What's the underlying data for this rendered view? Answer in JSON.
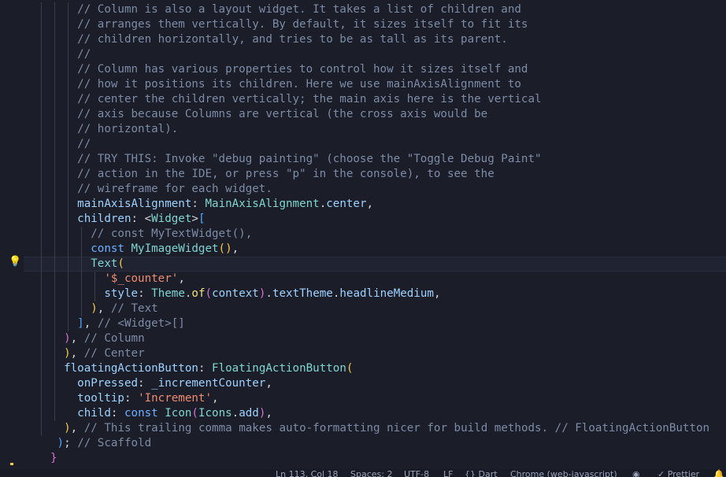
{
  "editor": {
    "lines": [
      [
        [
          "c",
          "    // Column is also a layout widget. It takes a list of children and"
        ]
      ],
      [
        [
          "c",
          "    // arranges them vertically. By default, it sizes itself to fit its"
        ]
      ],
      [
        [
          "c",
          "    // children horizontally, and tries to be as tall as its parent."
        ]
      ],
      [
        [
          "c",
          "    //"
        ]
      ],
      [
        [
          "c",
          "    // Column has various properties to control how it sizes itself and"
        ]
      ],
      [
        [
          "c",
          "    // how it positions its children. Here we use mainAxisAlignment to"
        ]
      ],
      [
        [
          "c",
          "    // center the children vertically; the main axis here is the vertical"
        ]
      ],
      [
        [
          "c",
          "    // axis because Columns are vertical (the cross axis would be"
        ]
      ],
      [
        [
          "c",
          "    // horizontal)."
        ]
      ],
      [
        [
          "c",
          "    //"
        ]
      ],
      [
        [
          "c",
          "    // TRY THIS: Invoke \"debug painting\" (choose the \"Toggle Debug Paint\""
        ]
      ],
      [
        [
          "c",
          "    // action in the IDE, or press \"p\" in the console), to see the"
        ]
      ],
      [
        [
          "c",
          "    // wireframe for each widget."
        ]
      ],
      [
        [
          "pu",
          "    "
        ],
        [
          "p",
          "mainAxisAlignment"
        ],
        [
          "pu",
          ": "
        ],
        [
          "t",
          "MainAxisAlignment"
        ],
        [
          "pu",
          "."
        ],
        [
          "p",
          "center"
        ],
        [
          "pu",
          ","
        ]
      ],
      [
        [
          "pu",
          "    "
        ],
        [
          "p",
          "children"
        ],
        [
          "pu",
          ": <"
        ],
        [
          "t",
          "Widget"
        ],
        [
          "pu",
          ">"
        ],
        [
          "bb",
          "["
        ]
      ],
      [
        [
          "pu",
          "      "
        ],
        [
          "c",
          "// const MyTextWidget(),"
        ]
      ],
      [
        [
          "pu",
          "      "
        ],
        [
          "k",
          "const "
        ],
        [
          "t",
          "MyImageWidget"
        ],
        [
          "by",
          "()"
        ],
        [
          "pu",
          ","
        ]
      ],
      [
        [
          "pu",
          "      "
        ],
        [
          "t",
          "Text"
        ],
        [
          "by",
          "("
        ]
      ],
      [
        [
          "pu",
          "        "
        ],
        [
          "s",
          "'$_counter'"
        ],
        [
          "pu",
          ","
        ]
      ],
      [
        [
          "pu",
          "        "
        ],
        [
          "p",
          "style"
        ],
        [
          "pu",
          ": "
        ],
        [
          "t",
          "Theme"
        ],
        [
          "pu",
          "."
        ],
        [
          "f",
          "of"
        ],
        [
          "bp",
          "("
        ],
        [
          "p",
          "context"
        ],
        [
          "bp",
          ")"
        ],
        [
          "pu",
          "."
        ],
        [
          "p",
          "textTheme"
        ],
        [
          "pu",
          "."
        ],
        [
          "p",
          "headlineMedium"
        ],
        [
          "pu",
          ","
        ]
      ],
      [
        [
          "pu",
          "      "
        ],
        [
          "by",
          ")"
        ],
        [
          "pu",
          ", "
        ],
        [
          "c",
          "// Text"
        ]
      ],
      [
        [
          "pu",
          "    "
        ],
        [
          "bb",
          "]"
        ],
        [
          "pu",
          ", "
        ],
        [
          "c",
          "// <Widget>[]"
        ]
      ],
      [
        [
          "pu",
          "  "
        ],
        [
          "bp",
          ")"
        ],
        [
          "pu",
          ", "
        ],
        [
          "c",
          "// Column"
        ]
      ],
      [
        [
          "pu",
          "  "
        ],
        [
          "by",
          ")"
        ],
        [
          "pu",
          ", "
        ],
        [
          "c",
          "// Center"
        ]
      ],
      [
        [
          "pu",
          "  "
        ],
        [
          "p",
          "floatingActionButton"
        ],
        [
          "pu",
          ": "
        ],
        [
          "t",
          "FloatingActionButton"
        ],
        [
          "by",
          "("
        ]
      ],
      [
        [
          "pu",
          "    "
        ],
        [
          "p",
          "onPressed"
        ],
        [
          "pu",
          ": "
        ],
        [
          "p",
          "_incrementCounter"
        ],
        [
          "pu",
          ","
        ]
      ],
      [
        [
          "pu",
          "    "
        ],
        [
          "p",
          "tooltip"
        ],
        [
          "pu",
          ": "
        ],
        [
          "s",
          "'Increment'"
        ],
        [
          "pu",
          ","
        ]
      ],
      [
        [
          "pu",
          "    "
        ],
        [
          "p",
          "child"
        ],
        [
          "pu",
          ": "
        ],
        [
          "k",
          "const "
        ],
        [
          "t",
          "Icon"
        ],
        [
          "bp",
          "("
        ],
        [
          "t",
          "Icons"
        ],
        [
          "pu",
          "."
        ],
        [
          "p",
          "add"
        ],
        [
          "bp",
          ")"
        ],
        [
          "pu",
          ","
        ]
      ],
      [
        [
          "pu",
          "  "
        ],
        [
          "by",
          ")"
        ],
        [
          "pu",
          ", "
        ],
        [
          "c",
          "// This trailing comma makes auto-formatting nicer for build methods. // FloatingActionButton"
        ]
      ],
      [
        [
          "pu",
          " "
        ],
        [
          "bb",
          ")"
        ],
        [
          "pu",
          "; "
        ],
        [
          "c",
          "// Scaffold"
        ]
      ],
      [
        [
          "bp",
          "}"
        ]
      ]
    ],
    "line_indents": [
      4,
      4,
      4,
      4,
      4,
      4,
      4,
      4,
      4,
      4,
      4,
      4,
      4,
      4,
      4,
      6,
      6,
      6,
      8,
      8,
      6,
      4,
      2,
      2,
      2,
      4,
      4,
      4,
      2,
      1,
      0
    ]
  },
  "status": {
    "position": "Ln 113, Col 18",
    "spaces": "Spaces: 2",
    "encoding": "UTF-8",
    "eol": "LF",
    "language": "{} Dart",
    "device": "Chrome (web-javascript)",
    "formatter": "✓ Prettier"
  }
}
